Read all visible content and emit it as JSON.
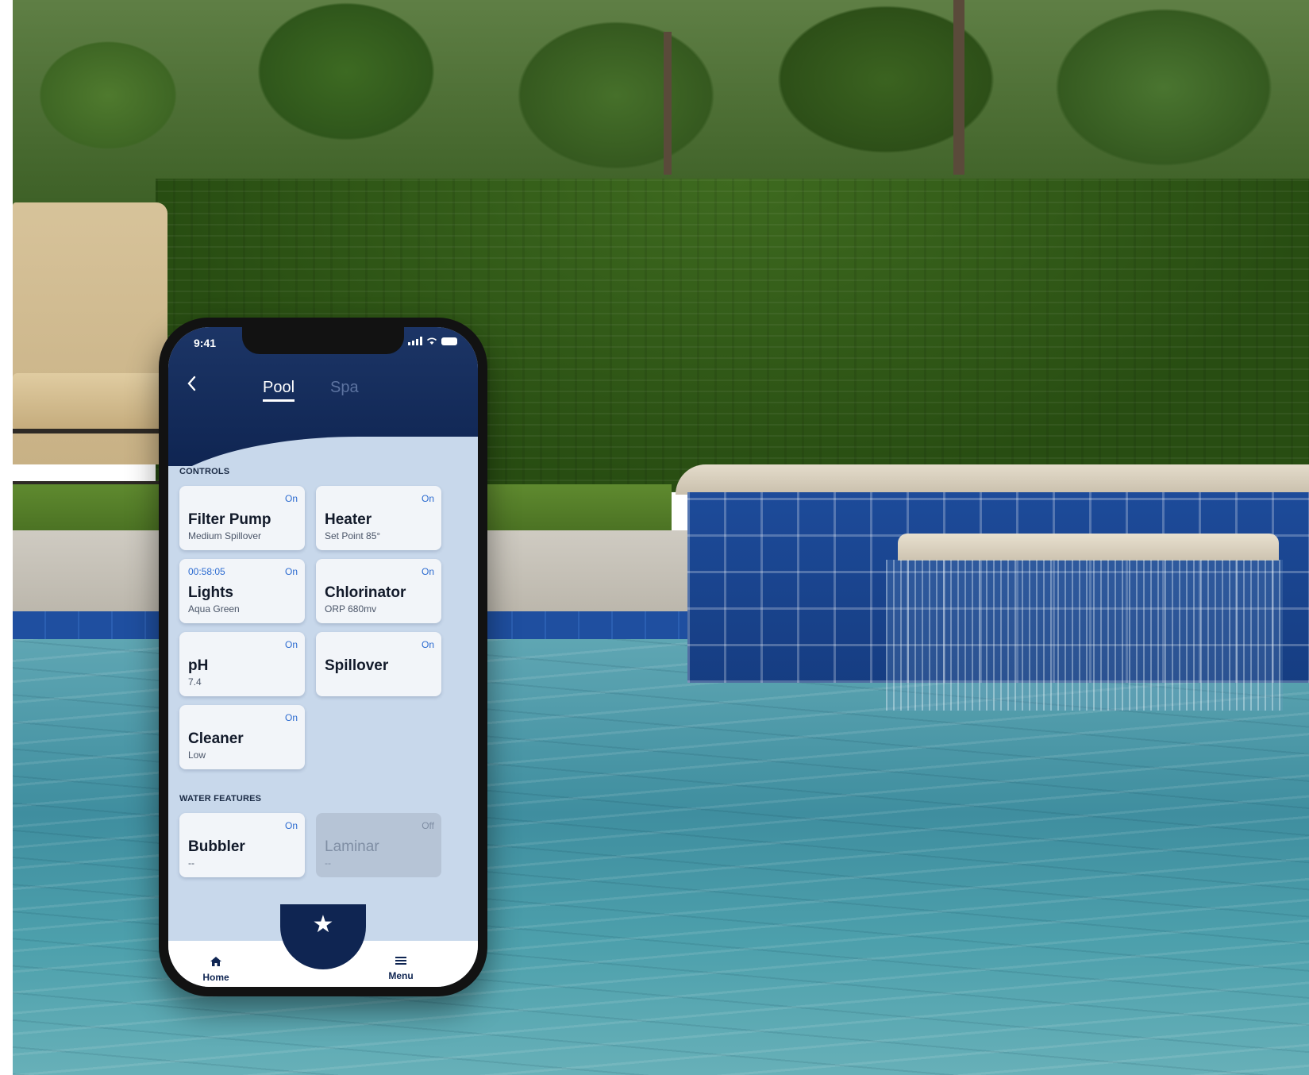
{
  "status_bar": {
    "time": "9:41"
  },
  "header": {
    "back_icon": "chevron-left-icon",
    "tabs": [
      {
        "label": "Pool",
        "active": true
      },
      {
        "label": "Spa",
        "active": false
      }
    ]
  },
  "controls": {
    "label": "CONTROLS",
    "cards": [
      {
        "name": "Filter Pump",
        "sub": "Medium Spillover",
        "state": "On"
      },
      {
        "name": "Heater",
        "sub": "Set Point 85°",
        "state": "On"
      },
      {
        "name": "Lights",
        "sub": "Aqua Green",
        "state": "On",
        "timer": "00:58:05"
      },
      {
        "name": "Chlorinator",
        "sub": "ORP 680mv",
        "state": "On"
      },
      {
        "name": "pH",
        "sub": "7.4",
        "state": "On"
      },
      {
        "name": "Spillover",
        "sub": "",
        "state": "On"
      },
      {
        "name": "Cleaner",
        "sub": "Low",
        "state": "On"
      }
    ]
  },
  "water_features": {
    "label": "WATER FEATURES",
    "cards": [
      {
        "name": "Bubbler",
        "sub": "--",
        "state": "On"
      },
      {
        "name": "Laminar",
        "sub": "--",
        "state": "Off"
      }
    ]
  },
  "bottom_nav": {
    "home": {
      "label": "Home",
      "icon": "home-icon"
    },
    "favorites": {
      "icon": "star-icon"
    },
    "menu": {
      "label": "Menu",
      "icon": "menu-icon"
    }
  },
  "colors": {
    "header_navy": "#0f2552",
    "accent_blue": "#2c6bd0",
    "screen_bg": "#c8d8eb"
  }
}
